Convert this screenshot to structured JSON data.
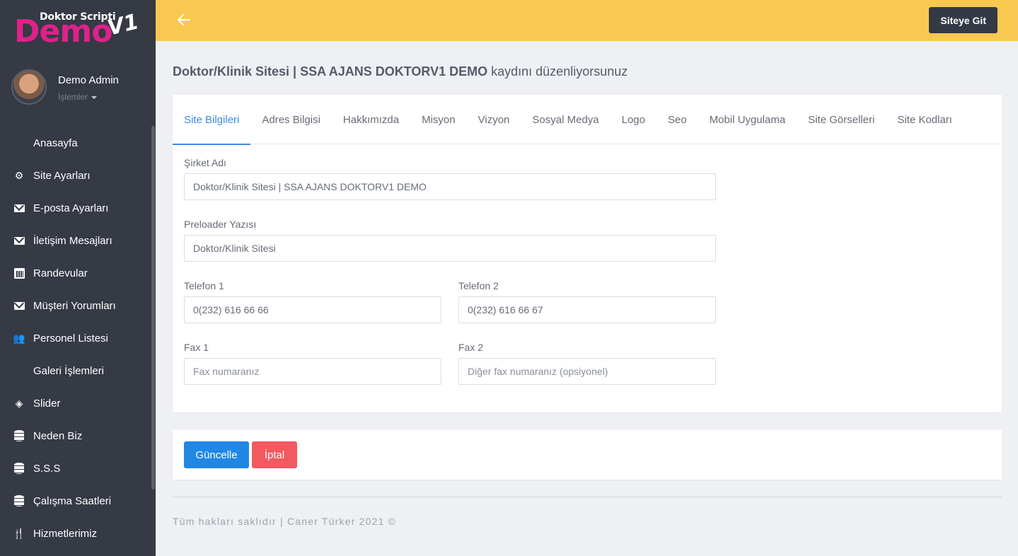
{
  "brand": {
    "small": "Doktor Scripti",
    "big": "Demo",
    "version": "V1",
    "brand_color": "#e0218a"
  },
  "user": {
    "name": "Demo Admin",
    "menu_label": "İşlemler"
  },
  "sidebar": {
    "items": [
      {
        "label": "Anasayfa",
        "icon": "dashboard-icon"
      },
      {
        "label": "Site Ayarları",
        "icon": "gear-icon"
      },
      {
        "label": "E-posta Ayarları",
        "icon": "mail-icon"
      },
      {
        "label": "İletişim Mesajları",
        "icon": "mail-icon"
      },
      {
        "label": "Randevular",
        "icon": "calendar-icon"
      },
      {
        "label": "Müşteri Yorumları",
        "icon": "mail-icon"
      },
      {
        "label": "Personel Listesi",
        "icon": "users-icon"
      },
      {
        "label": "Galeri İşlemleri",
        "icon": "grid-icon"
      },
      {
        "label": "Slider",
        "icon": "layers-icon"
      },
      {
        "label": "Neden Biz",
        "icon": "database-icon"
      },
      {
        "label": "S.S.S",
        "icon": "database-icon"
      },
      {
        "label": "Çalışma Saatleri",
        "icon": "database-icon"
      },
      {
        "label": "Hizmetlerimiz",
        "icon": "cutlery-icon"
      }
    ]
  },
  "topbar": {
    "back_icon": "arrow-left-icon",
    "go_site_label": "Siteye Git",
    "bar_color": "#f9c850"
  },
  "page": {
    "title_bold": "Doktor/Klinik Sitesi | SSA AJANS DOKTORV1 DEMO",
    "title_rest": " kaydını düzenliyorsunuz"
  },
  "tabs": [
    {
      "label": "Site Bilgileri",
      "active": true
    },
    {
      "label": "Adres Bilgisi"
    },
    {
      "label": "Hakkımızda"
    },
    {
      "label": "Misyon"
    },
    {
      "label": "Vizyon"
    },
    {
      "label": "Sosyal Medya"
    },
    {
      "label": "Logo"
    },
    {
      "label": "Seo"
    },
    {
      "label": "Mobil Uygulama"
    },
    {
      "label": "Site Görselleri"
    },
    {
      "label": "Site Kodları"
    }
  ],
  "form": {
    "company": {
      "label": "Şirket Adı",
      "value": "Doktor/Klinik Sitesi | SSA AJANS DOKTORV1 DEMO"
    },
    "preloader": {
      "label": "Preloader Yazısı",
      "value": "Doktor/Klinik Sitesi"
    },
    "phone1": {
      "label": "Telefon 1",
      "value": "0(232) 616 66 66"
    },
    "phone2": {
      "label": "Telefon 2",
      "value": "0(232) 616 66 67"
    },
    "fax1": {
      "label": "Fax 1",
      "value": "",
      "placeholder": "Fax numaranız"
    },
    "fax2": {
      "label": "Fax 2",
      "value": "",
      "placeholder": "Diğer fax numaranız (opsiyonel)"
    }
  },
  "actions": {
    "update_label": "Güncelle",
    "cancel_label": "İptal",
    "update_color": "#1f88e5",
    "cancel_color": "#f25961"
  },
  "footer": {
    "text": "Tüm hakları saklıdır | Caner Türker 2021 ©"
  }
}
